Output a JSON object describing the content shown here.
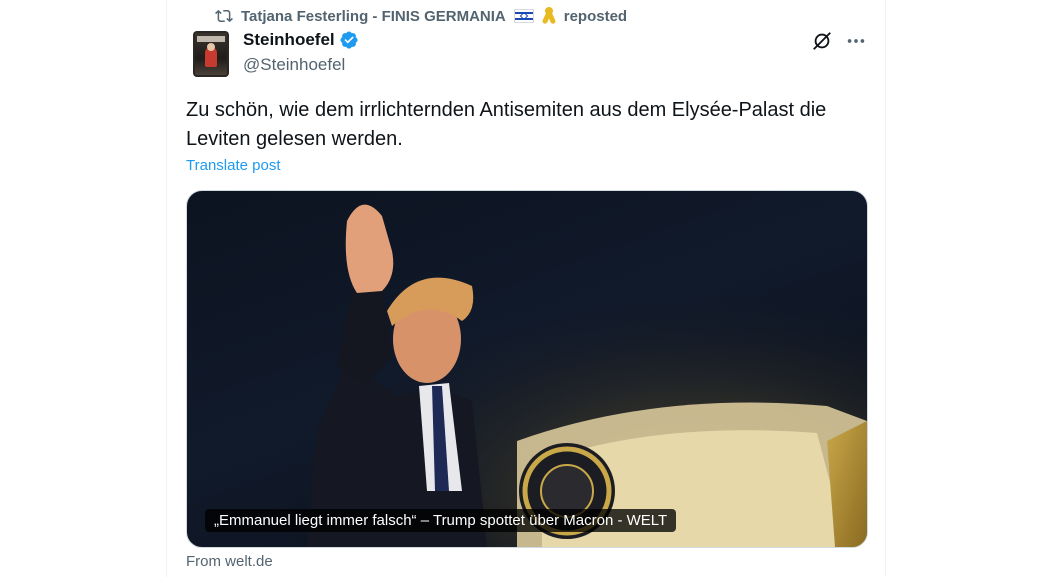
{
  "repost": {
    "reposter_name": "Tatjana Festerling - FINIS GERMANIA",
    "reposted_label": "reposted",
    "icon": "repost-icon"
  },
  "author": {
    "display_name": "Steinhoefel",
    "handle": "@Steinhoefel",
    "verified": true,
    "verified_color": "#1d9bf0"
  },
  "post": {
    "text": "Zu schön, wie dem irrlichternden Antisemiten aus dem Elysée-Palast die Leviten gelesen werden.",
    "translate_label": "Translate post"
  },
  "card": {
    "caption": "„Emmanuel liegt immer falsch“ – Trump spottet über Macron - WELT",
    "source": "From welt.de"
  },
  "colors": {
    "text": "#0f1419",
    "secondary": "#536471",
    "link": "#1d9bf0",
    "border": "#eff3f4"
  }
}
